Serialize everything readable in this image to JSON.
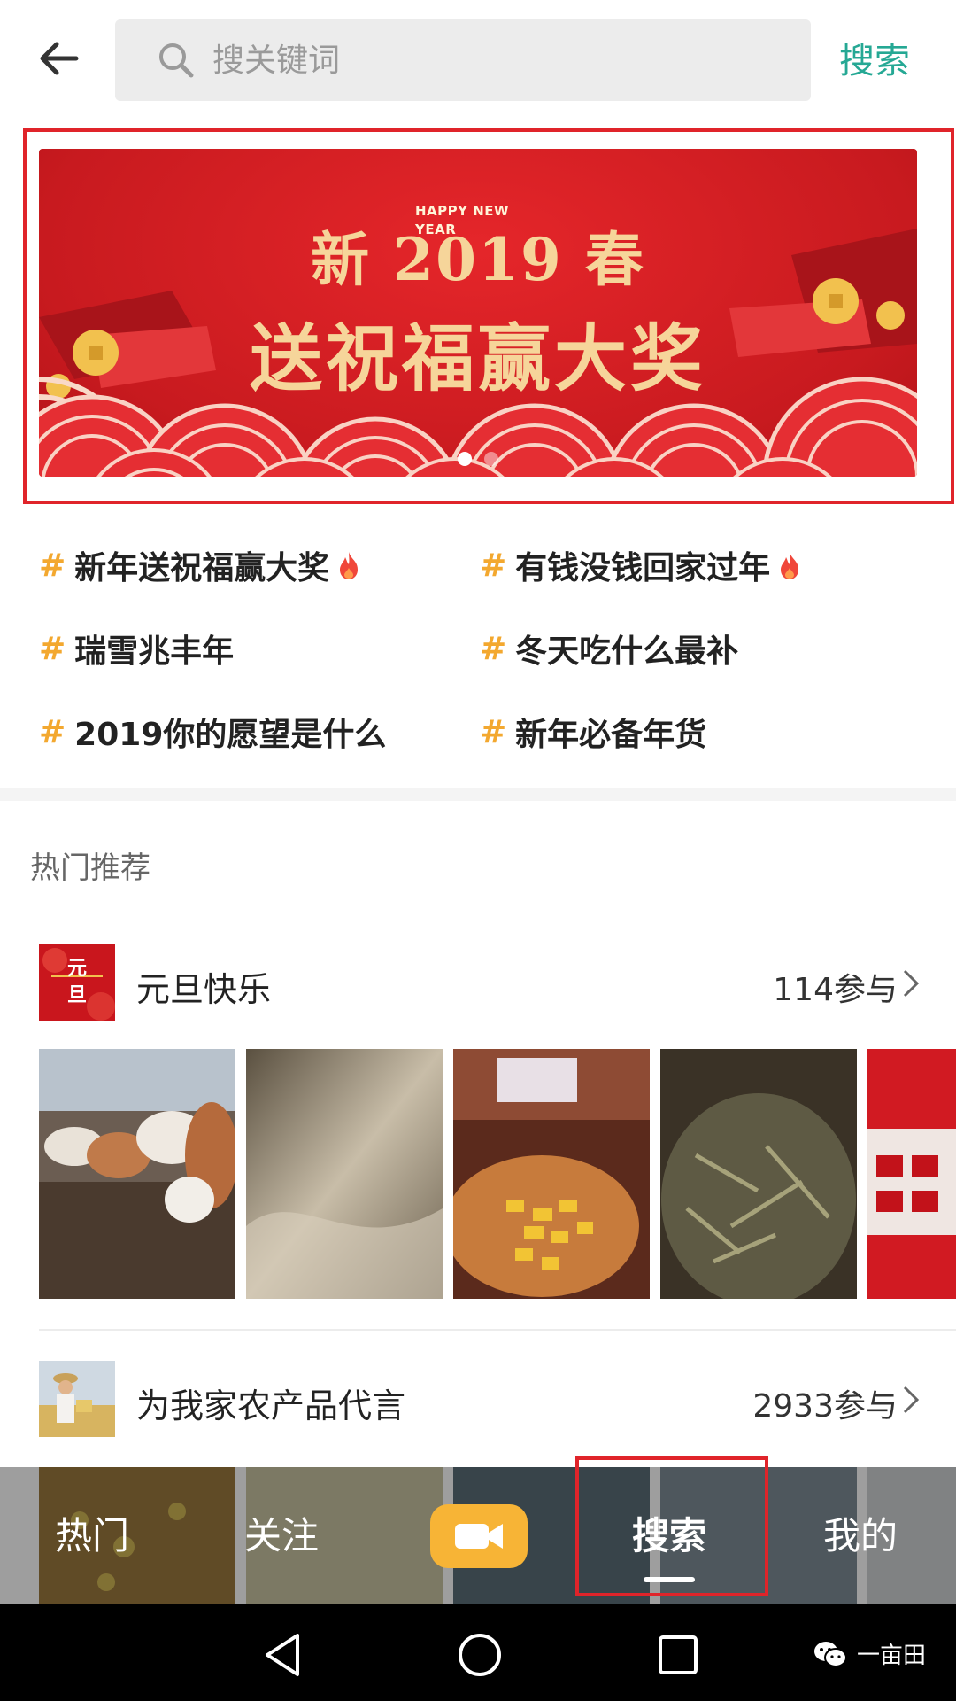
{
  "header": {
    "search_placeholder": "搜关键词",
    "search_button": "搜索"
  },
  "banner": {
    "happy_line1": "HAPPY NEW",
    "happy_line2": "YEAR",
    "line1": "新 2019 春",
    "line2": "送祝福赢大奖",
    "page_count": 2,
    "active_page": 1
  },
  "hashtags": {
    "hash_symbol": "#",
    "items": [
      {
        "label": "新年送祝福赢大奖",
        "hot": true
      },
      {
        "label": "有钱没钱回家过年",
        "hot": true
      },
      {
        "label": "瑞雪兆丰年",
        "hot": false
      },
      {
        "label": "冬天吃什么最补",
        "hot": false
      },
      {
        "label": "2019你的愿望是什么",
        "hot": false
      },
      {
        "label": "新年必备年货",
        "hot": false
      }
    ]
  },
  "section": {
    "title": "热门推荐"
  },
  "topics": [
    {
      "name": "元旦快乐",
      "count": "114参与",
      "thumb_text": "元旦"
    },
    {
      "name": "为我家农产品代言",
      "count": "2933参与"
    }
  ],
  "tabs": {
    "hot": "热门",
    "follow": "关注",
    "search": "搜索",
    "mine": "我的"
  },
  "watermark": {
    "text": "一亩田"
  },
  "colors": {
    "accent_green": "#25a894",
    "banner_red": "#c81a1f",
    "hash_orange": "#f3a82f",
    "record_yellow": "#f7b436",
    "highlight_red": "#e0242a"
  }
}
